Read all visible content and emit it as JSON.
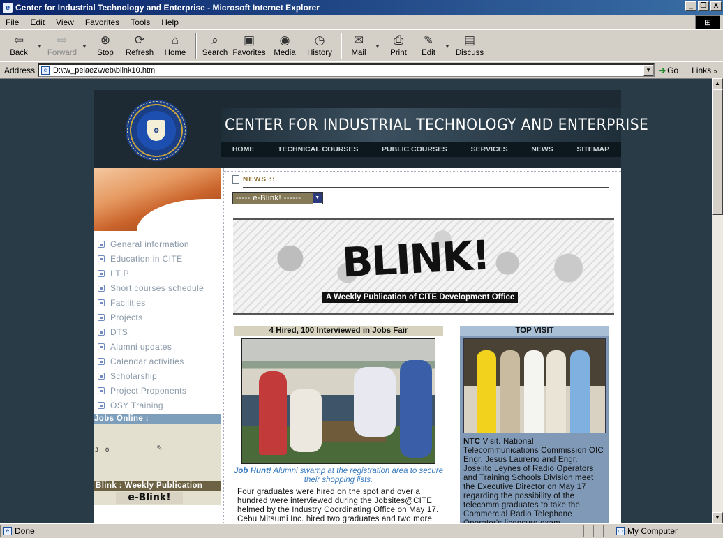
{
  "window": {
    "title": "Center for Industrial Technology and Enterprise - Microsoft Internet Explorer",
    "buttons": [
      "_",
      "❐",
      "X"
    ]
  },
  "menu": [
    "File",
    "Edit",
    "View",
    "Favorites",
    "Tools",
    "Help"
  ],
  "toolbar": {
    "back": "Back",
    "forward": "Forward",
    "stop": "Stop",
    "refresh": "Refresh",
    "home": "Home",
    "search": "Search",
    "favorites": "Favorites",
    "media": "Media",
    "history": "History",
    "mail": "Mail",
    "print": "Print",
    "edit": "Edit",
    "discuss": "Discuss"
  },
  "address": {
    "label": "Address",
    "value": "D:\\tw_pelaez\\web\\blink10.htm",
    "go": "Go",
    "links": "Links"
  },
  "status": {
    "text": "Done",
    "zone": "My Computer"
  },
  "site": {
    "banner_title": "CENTER FOR INDUSTRIAL TECHNOLOGY AND ENTERPRISE",
    "nav": [
      "HOME",
      "TECHNICAL COURSES",
      "PUBLIC COURSES",
      "SERVICES",
      "NEWS",
      "SITEMAP"
    ],
    "sidebar": [
      "General information",
      "Education in CITE",
      "I T P",
      "Short courses schedule",
      "Facilities",
      "Projects",
      "DTS",
      "Alumni updates",
      "Calendar activities",
      "Scholarship",
      "Project Proponents",
      "OSY Training"
    ],
    "jobs_online": "Jobs Online :",
    "jobs_ticker": "J O",
    "blink_pub": "Blink : Weekly Publication",
    "blink_logo": "e-Blink!",
    "news_label": "NEWS ::",
    "eblink_select": "----- e-Blink! ------",
    "banner_word": "BLINK!",
    "banner_tagline": "A Weekly Publication of CITE Development Office",
    "left_article": {
      "headline": "4 Hired, 100 Interviewed in Jobs Fair",
      "caption_bold": "Job Hunt!",
      "caption": " Alumni swamp at the registration area to secure their shopping lists.",
      "body": "Four graduates were hired on the spot and over a hundred were interviewed during the Jobsites@CITE helmed by the Industry Coordinating Office on May 17. Cebu Mitsumi Inc. hired two graduates and two more joined Offshore Eng'g & Marine Services."
    },
    "right_article": {
      "headline": "TOP VISIT",
      "lead": "NTC",
      "body": " Visit. National Telecommunications Commission OIC Engr. Jesus Laureno and Engr. Joselito Leynes of Radio Operators and Training Schools Division meet the Executive Director on May 17 regarding the possibility of the telecomm graduates to take the Commercial Radio Telephone Operator's licensure exam"
    }
  }
}
